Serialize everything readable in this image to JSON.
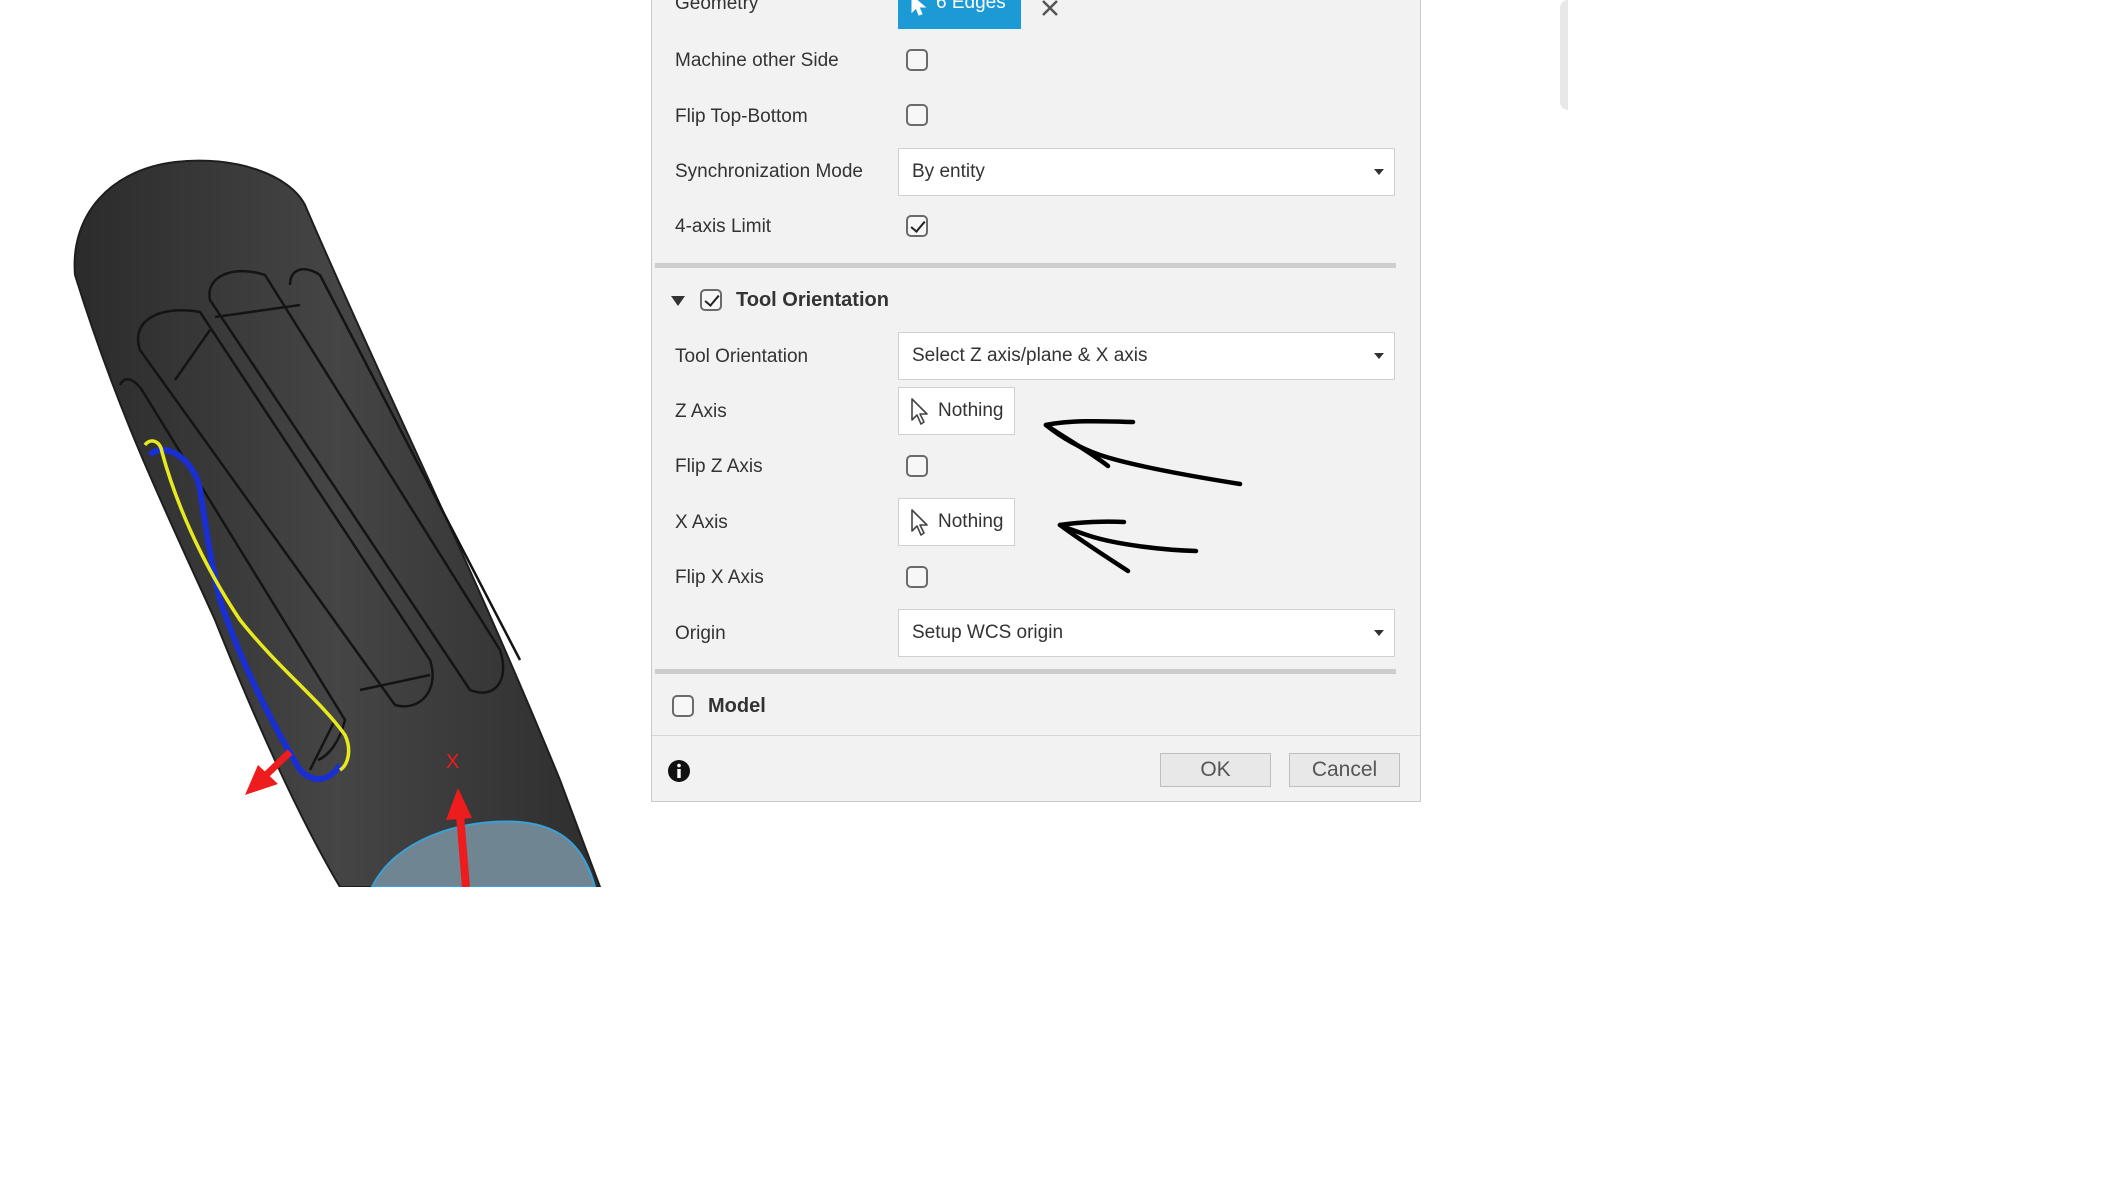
{
  "dialog": {
    "geometry": {
      "label": "Geometry",
      "selection": "6 Edges"
    },
    "machine_other_side": {
      "label": "Machine other Side",
      "checked": false
    },
    "flip_top_bottom": {
      "label": "Flip Top-Bottom",
      "checked": false
    },
    "synchronization_mode": {
      "label": "Synchronization Mode",
      "value": "By entity"
    },
    "four_axis_limit": {
      "label": "4-axis Limit",
      "checked": true
    },
    "tool_orientation_section": {
      "title": "Tool Orientation",
      "checked": true,
      "expanded": true
    },
    "tool_orientation": {
      "label": "Tool Orientation",
      "value": "Select Z axis/plane & X axis"
    },
    "z_axis": {
      "label": "Z Axis",
      "value": "Nothing"
    },
    "flip_z_axis": {
      "label": "Flip Z Axis",
      "checked": false
    },
    "x_axis": {
      "label": "X Axis",
      "value": "Nothing"
    },
    "flip_x_axis": {
      "label": "Flip X Axis",
      "checked": false
    },
    "origin": {
      "label": "Origin",
      "value": "Setup WCS origin"
    },
    "model_section": {
      "title": "Model",
      "checked": false
    },
    "footer": {
      "ok_label": "OK",
      "cancel_label": "Cancel"
    }
  },
  "viewport": {
    "axis_label": "X"
  },
  "colors": {
    "accent": "#1c9ad6",
    "selection_blue": "#1a2fd1",
    "selection_yellow": "#e8ea1f",
    "axis_red": "#ee1c1c",
    "part_dark": "#3a3a3a",
    "face_blue": "#6f8591"
  }
}
